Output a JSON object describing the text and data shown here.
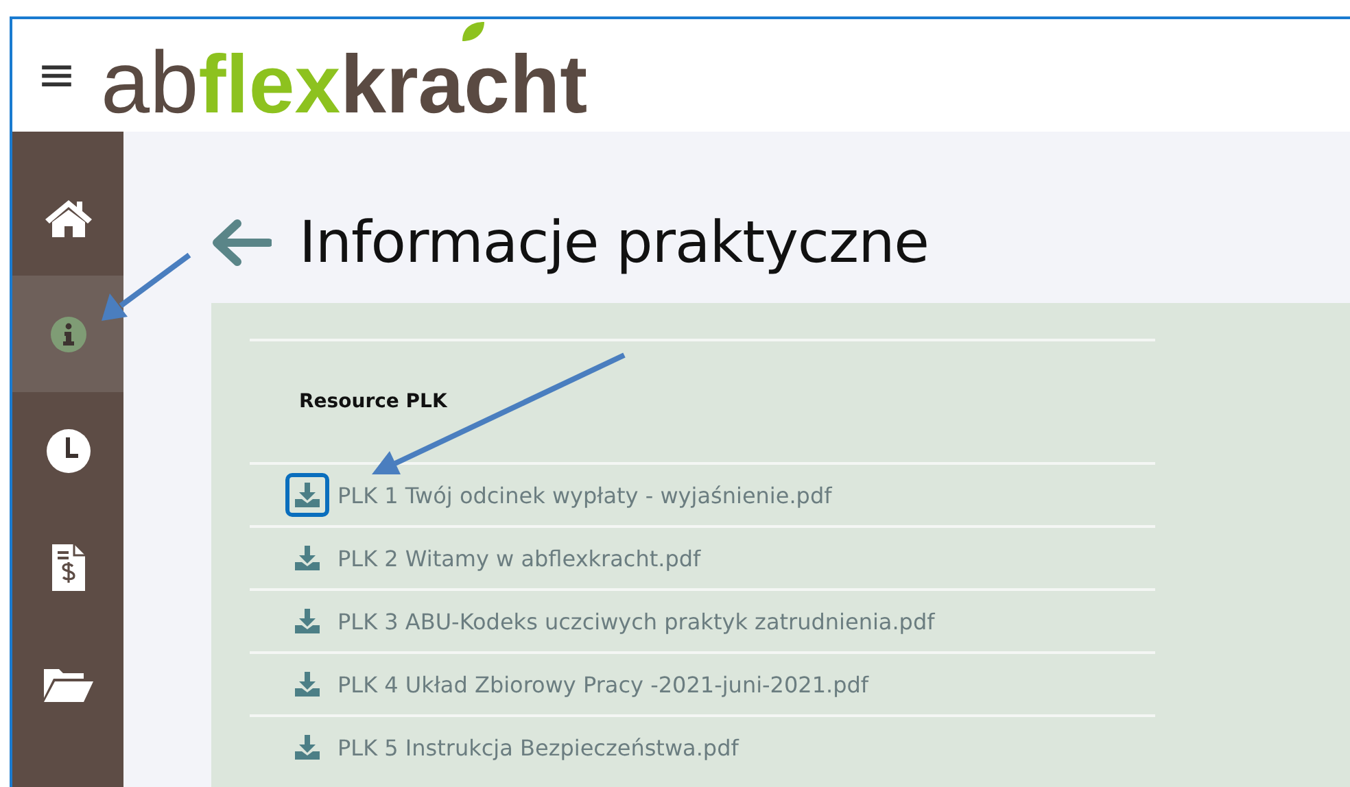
{
  "header": {
    "menu_glyph": "≡",
    "logo": {
      "prefix": "ab",
      "highlight": "flex",
      "suffix": "kracht"
    }
  },
  "sidebar": {
    "items": [
      {
        "kind": "home",
        "selected": false
      },
      {
        "kind": "info",
        "selected": true
      },
      {
        "kind": "clock",
        "selected": false
      },
      {
        "kind": "invoice",
        "selected": false
      },
      {
        "kind": "folder",
        "selected": false
      }
    ]
  },
  "page": {
    "title": "Informacje praktyczne"
  },
  "resources": {
    "heading": "Resource PLK",
    "files": [
      {
        "name": "PLK 1 Twój odcinek wypłaty - wyjaśnienie.pdf",
        "highlighted": true
      },
      {
        "name": "PLK 2 Witamy w abflexkracht.pdf",
        "highlighted": false
      },
      {
        "name": "PLK 3 ABU-Kodeks uczciwych praktyk zatrudnienia.pdf",
        "highlighted": false
      },
      {
        "name": "PLK 4 Układ Zbiorowy Pracy -2021-juni-2021.pdf",
        "highlighted": false
      },
      {
        "name": "PLK 5 Instrukcja Bezpieczeństwa.pdf",
        "highlighted": false
      }
    ]
  }
}
